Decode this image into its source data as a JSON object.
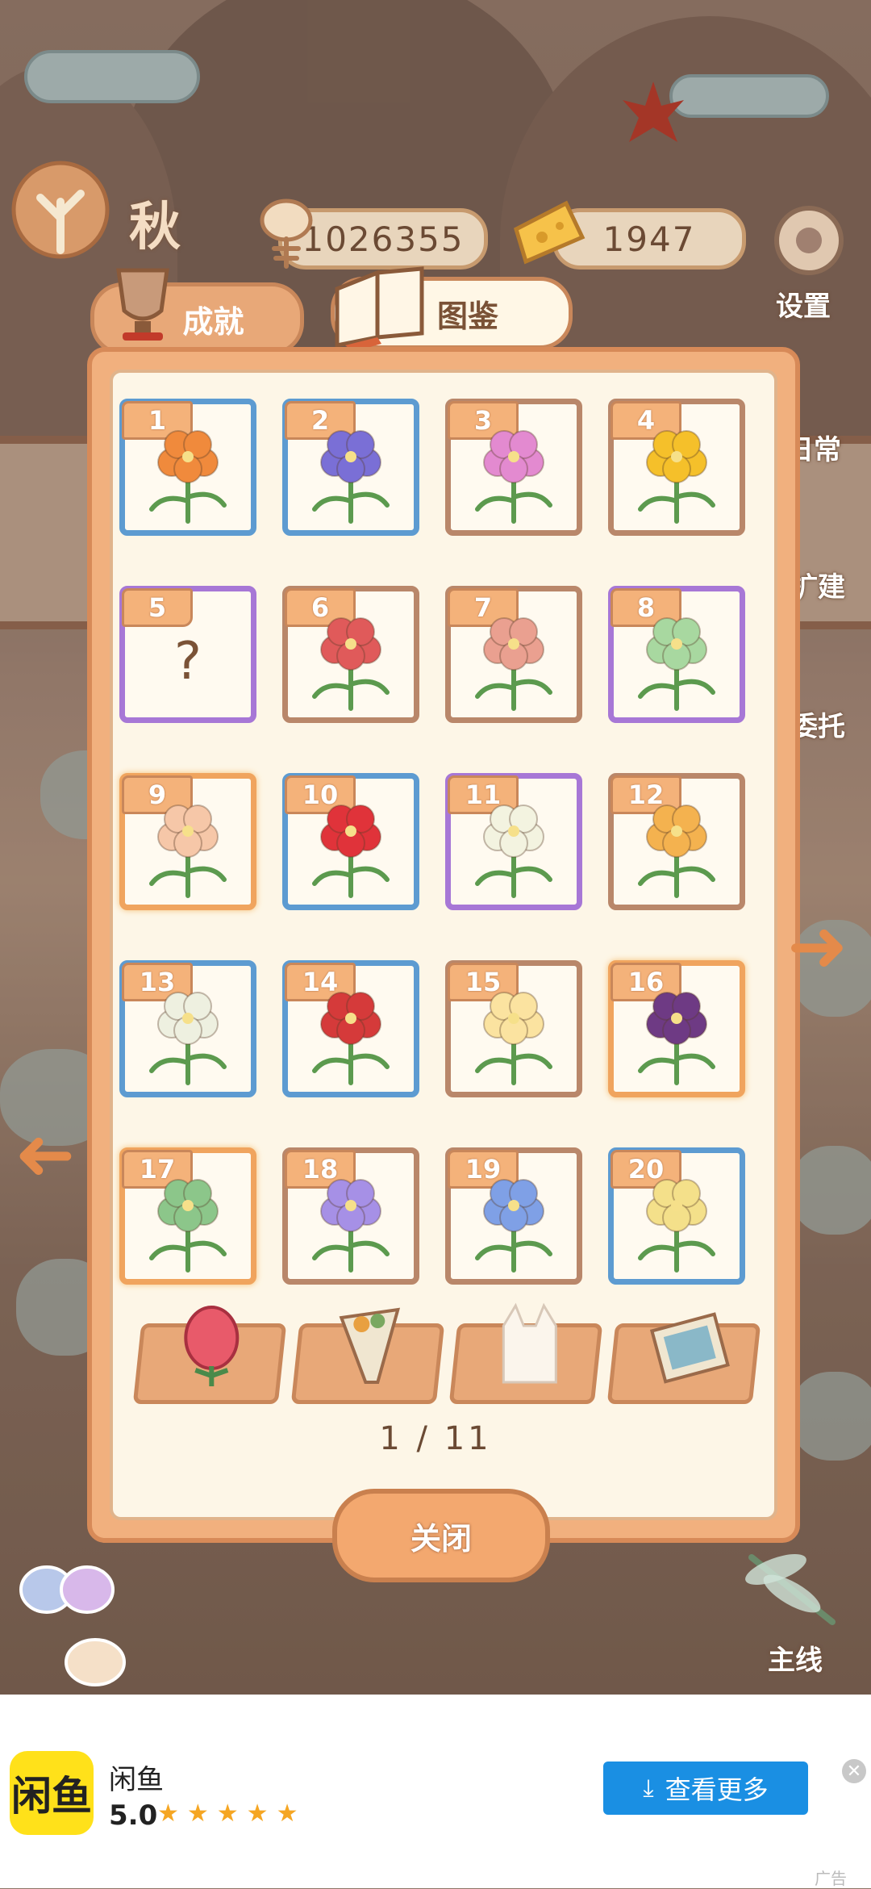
{
  "hud": {
    "season": "秋",
    "fish_count": "1026355",
    "cheese_count": "1947",
    "settings_label": "设置"
  },
  "side_menu": [
    "日常",
    "扩建",
    "委托",
    "主线"
  ],
  "tabs": [
    {
      "label": "成就",
      "icon": "trophy-icon"
    },
    {
      "label": "图鉴",
      "icon": "book-icon"
    }
  ],
  "cards": [
    {
      "num": "1",
      "rarity": "blue",
      "flower": "bird-of-paradise",
      "color": "#f08a3c"
    },
    {
      "num": "2",
      "rarity": "blue",
      "flower": "bellflower",
      "color": "#7a6fd6"
    },
    {
      "num": "3",
      "rarity": "brown",
      "flower": "pink-cluster",
      "color": "#e38ad0"
    },
    {
      "num": "4",
      "rarity": "brown",
      "flower": "sunflower",
      "color": "#f5c02a"
    },
    {
      "num": "5",
      "rarity": "purple",
      "flower": "unknown",
      "color": "#7a5236",
      "text": "?"
    },
    {
      "num": "6",
      "rarity": "brown",
      "flower": "red-spike",
      "color": "#e05a5a"
    },
    {
      "num": "7",
      "rarity": "brown",
      "flower": "hoya",
      "color": "#eaa090"
    },
    {
      "num": "8",
      "rarity": "purple",
      "flower": "green-star",
      "color": "#a8d8a0"
    },
    {
      "num": "9",
      "rarity": "orange",
      "flower": "rainbow-petals",
      "color": "#f6c7a8"
    },
    {
      "num": "10",
      "rarity": "blue",
      "flower": "red-spider-lily",
      "color": "#e0333a"
    },
    {
      "num": "11",
      "rarity": "purple",
      "flower": "white-trumpet",
      "color": "#f3f3e0"
    },
    {
      "num": "12",
      "rarity": "brown",
      "flower": "orange-tulip",
      "color": "#f4b24f"
    },
    {
      "num": "13",
      "rarity": "blue",
      "flower": "white-egret",
      "color": "#eef0e0"
    },
    {
      "num": "14",
      "rarity": "blue",
      "flower": "red-lips",
      "color": "#d53a3a"
    },
    {
      "num": "15",
      "rarity": "brown",
      "flower": "plumeria",
      "color": "#fbe3a0"
    },
    {
      "num": "16",
      "rarity": "orange",
      "flower": "purple-rose",
      "color": "#6e3a84"
    },
    {
      "num": "17",
      "rarity": "orange",
      "flower": "green-cone",
      "color": "#8cc68a"
    },
    {
      "num": "18",
      "rarity": "brown",
      "flower": "purple-phlox",
      "color": "#a690e6"
    },
    {
      "num": "19",
      "rarity": "brown",
      "flower": "blue-phlox",
      "color": "#7fa0e6"
    },
    {
      "num": "20",
      "rarity": "blue",
      "flower": "yellow-phlox",
      "color": "#f4e08a"
    }
  ],
  "categories": [
    "rose-bud-icon",
    "bouquet-icon",
    "cat-silhouette-icon",
    "photo-icon"
  ],
  "pager": {
    "current": "1",
    "total": "11",
    "text": "1 / 11"
  },
  "close_label": "关闭",
  "ad": {
    "logo_text": "闲鱼",
    "app_name": "闲鱼",
    "rating": "5.0",
    "stars": "★★★★★",
    "button_label": "查看更多",
    "tag": "广告"
  }
}
